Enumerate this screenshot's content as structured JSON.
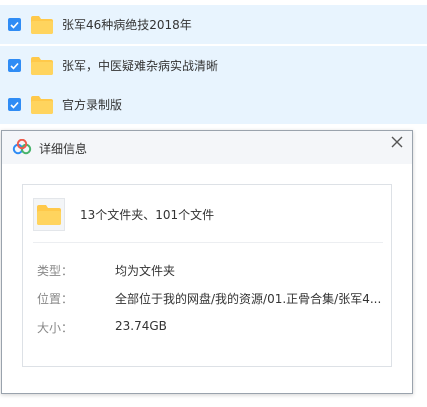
{
  "file_list": {
    "items": [
      {
        "name": "张军46种病绝技2018年",
        "checked": true
      },
      {
        "name": "张军，中医疑难杂病实战清晰",
        "checked": true
      },
      {
        "name": "官方录制版",
        "checked": true
      }
    ]
  },
  "dialog": {
    "title": "详细信息",
    "close_glyph": "✕",
    "summary": "13个文件夹、101个文件",
    "properties": {
      "type_label": "类型：",
      "type_value": "均为文件夹",
      "location_label": "位置：",
      "location_value": "全部位于我的网盘/我的资源/01.正骨合集/张军4...",
      "size_label": "大小：",
      "size_value": "23.74GB"
    }
  },
  "colors": {
    "row_highlight": "#e8f4fe",
    "checkbox_blue": "#2f8cf5",
    "folder_yellow": "#ffc94a"
  },
  "icons": {
    "checkbox": "checkbox-checked-icon",
    "folder": "folder-icon",
    "app": "baidu-netdisk-icon",
    "close": "close-icon"
  }
}
